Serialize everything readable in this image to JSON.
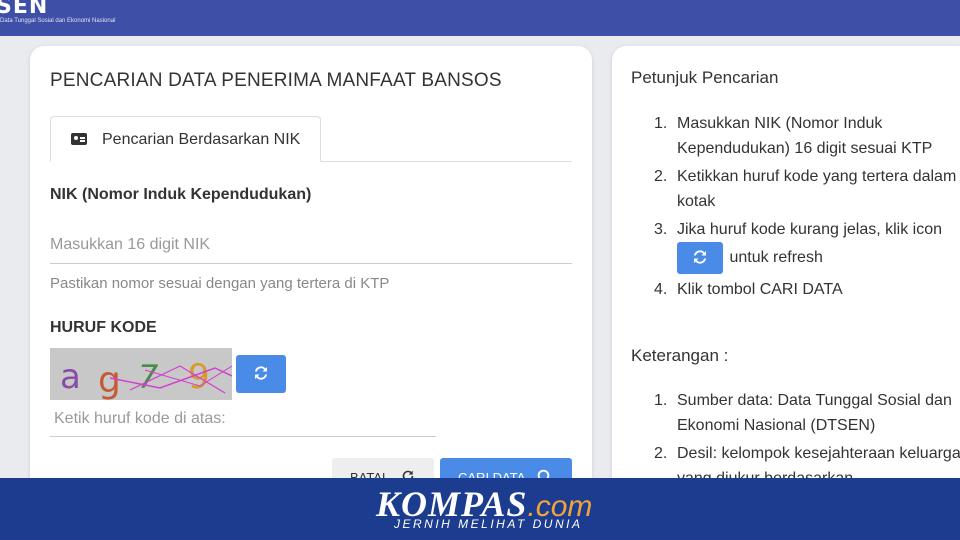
{
  "header": {
    "logo_text": "SEN",
    "logo_subtitle": "Data Tunggal Sosial dan Ekonomi Nasional",
    "bar_color": "#3d4fa6"
  },
  "form": {
    "title": "PENCARIAN DATA PENERIMA MANFAAT BANSOS",
    "tab_label": "Pencarian Berdasarkan NIK",
    "tab_icon": "id-card-icon",
    "nik_label": "NIK (Nomor Induk Kependudukan)",
    "nik_placeholder": "Masukkan 16 digit NIK",
    "nik_hint": "Pastikan nomor sesuai dengan yang tertera di KTP",
    "kode_label": "HURUF KODE",
    "captcha_text": "ag79",
    "kode_placeholder": "Ketik huruf kode di atas:",
    "batal_label": "BATAL",
    "cari_label": "CARI DATA",
    "accent_color": "#4a8be8"
  },
  "guide": {
    "title": "Petunjuk Pencarian",
    "steps": [
      "Masukkan NIK (Nomor Induk Kependudukan) 16 digit sesuai KTP",
      "Ketikkan huruf kode yang tertera dalam kotak",
      "Jika huruf kode kurang jelas, klik icon",
      "Klik tombol CARI DATA"
    ],
    "step3_suffix": "untuk refresh",
    "info_title": "Keterangan :",
    "info": [
      "Sumber data: Data Tunggal Sosial dan Ekonomi Nasional (DTSEN)",
      "Desil: kelompok kesejahteraan keluarga yang diukur berdasarkan"
    ]
  },
  "banner": {
    "brand": "KOMPAS",
    "brand_suffix": ".com",
    "tagline": "JERNIH MELIHAT DUNIA",
    "color": "#1c3c8f"
  }
}
